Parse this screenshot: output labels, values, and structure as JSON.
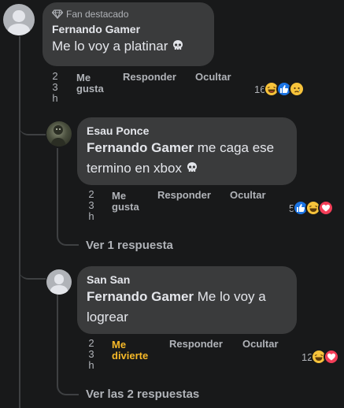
{
  "comment1": {
    "badge": "Fan destacado",
    "author": "Fernando Gamer",
    "text": "Me lo voy a platinar",
    "time_lines": [
      "2",
      "3",
      "h"
    ],
    "like": [
      "Me",
      "gusta"
    ],
    "reply": "Responder",
    "hide": "Ocultar",
    "reaction_count": "16",
    "reactions": [
      "haha-icon",
      "like-icon",
      "sad-icon"
    ]
  },
  "comment2": {
    "author": "Esau Ponce",
    "mention": "Fernando Gamer",
    "text_line1": " me caga ese",
    "text_line2": "termino en xbox",
    "time_lines": [
      "2",
      "3",
      "h"
    ],
    "like": [
      "Me",
      "gusta"
    ],
    "reply": "Responder",
    "hide": "Ocultar",
    "reaction_count": "5",
    "reactions": [
      "like-icon",
      "haha-icon",
      "love-icon"
    ],
    "replies_link": "Ver 1 respuesta"
  },
  "comment3": {
    "author": "San San",
    "mention": "Fernando Gamer",
    "text_line1": " Me lo voy a",
    "text_line2": "logrear",
    "time_lines": [
      "2",
      "3",
      "h"
    ],
    "like": [
      "Me",
      "divierte"
    ],
    "reply": "Responder",
    "hide": "Ocultar",
    "reaction_count": "12",
    "reactions": [
      "haha-icon",
      "love-icon"
    ],
    "replies_link": "Ver las 2 respuestas"
  },
  "colors": {
    "background": "#18191a",
    "bubble": "#3a3b3c",
    "text": "#e4e6eb",
    "secondary": "#b0b3b8",
    "like_blue": "#1b74e4",
    "haha_yellow": "#f7b928"
  }
}
